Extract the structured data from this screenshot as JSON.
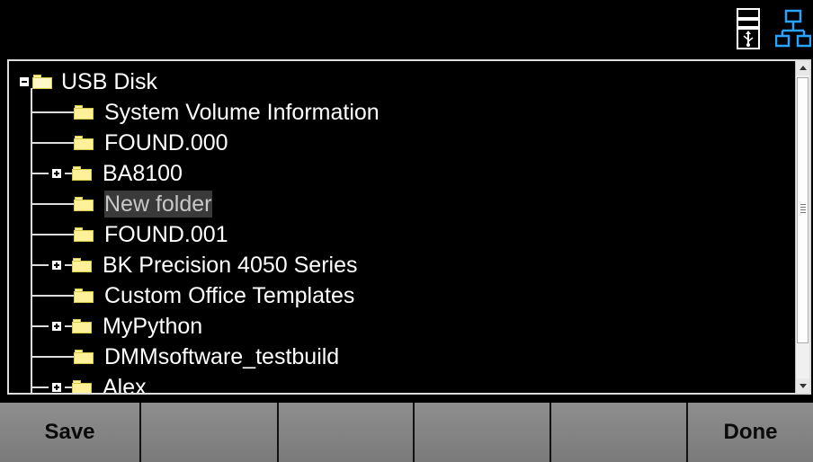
{
  "status_bar": {
    "icons": [
      "usb-storage-icon",
      "network-icon"
    ],
    "usb_icon_color": "#ffffff",
    "network_icon_color": "#2aa3ff"
  },
  "browser": {
    "root": {
      "label": "USB Disk",
      "expanded": true,
      "icon": "open-folder-icon"
    },
    "items": [
      {
        "label": "System Volume Information",
        "expandable": false,
        "selected": false
      },
      {
        "label": "FOUND.000",
        "expandable": false,
        "selected": false
      },
      {
        "label": "BA8100",
        "expandable": true,
        "selected": false
      },
      {
        "label": "New folder",
        "expandable": false,
        "selected": true
      },
      {
        "label": "FOUND.001",
        "expandable": false,
        "selected": false
      },
      {
        "label": "BK Precision 4050 Series",
        "expandable": true,
        "selected": false
      },
      {
        "label": "Custom Office Templates",
        "expandable": false,
        "selected": false
      },
      {
        "label": "MyPython",
        "expandable": true,
        "selected": false
      },
      {
        "label": "DMMsoftware_testbuild",
        "expandable": false,
        "selected": false
      },
      {
        "label": "Alex",
        "expandable": true,
        "selected": false
      }
    ],
    "folder_color": "#fff19a"
  },
  "softkeys": [
    {
      "label": "Save"
    },
    {
      "label": ""
    },
    {
      "label": ""
    },
    {
      "label": ""
    },
    {
      "label": ""
    },
    {
      "label": "Done"
    }
  ]
}
